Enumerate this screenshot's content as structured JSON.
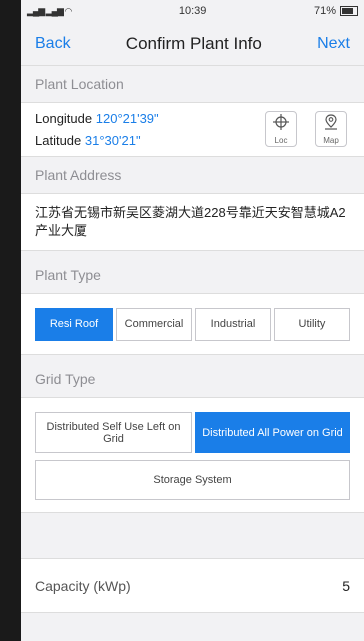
{
  "status": {
    "signal": "▂▄▆ ▂▄▆ ◠",
    "time": "10:39",
    "right": "71%"
  },
  "nav": {
    "back": "Back",
    "title": "Confirm Plant Info",
    "next": "Next"
  },
  "location": {
    "header": "Plant Location",
    "longitude_label": "Longitude",
    "longitude_value": "120°21'39\"",
    "latitude_label": "Latitude",
    "latitude_value": "31°30'21\"",
    "loc_button": "Loc",
    "map_button": "Map"
  },
  "address": {
    "header": "Plant Address",
    "value": "江苏省无锡市新吴区菱湖大道228号靠近天安智慧城A2产业大厦"
  },
  "plant_type": {
    "header": "Plant Type",
    "options": [
      "Resi Roof",
      "Commercial",
      "Industrial",
      "Utility"
    ],
    "selected": "Resi Roof"
  },
  "grid_type": {
    "header": "Grid Type",
    "options": [
      "Distributed Self Use Left on Grid",
      "Distributed All Power on Grid"
    ],
    "selected": "Distributed All Power on Grid",
    "storage": "Storage System"
  },
  "capacity": {
    "label": "Capacity (kWp)",
    "value": "5"
  },
  "colors": {
    "accent": "#1a7ee8",
    "background": "#f2f2f4"
  }
}
